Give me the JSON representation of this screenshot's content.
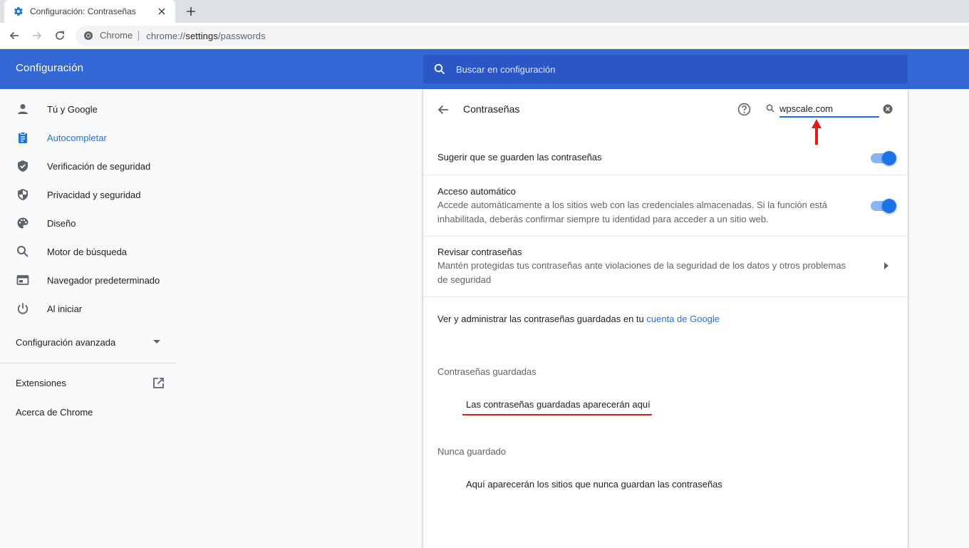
{
  "browser": {
    "tab_title": "Configuración: Contraseñas",
    "site_chip": "Chrome",
    "url_scheme": "chrome://",
    "url_host": "settings",
    "url_path": "/passwords"
  },
  "header": {
    "title": "Configuración",
    "search_placeholder": "Buscar en configuración"
  },
  "sidebar": {
    "items": [
      {
        "label": "Tú y Google",
        "icon": "person-icon"
      },
      {
        "label": "Autocompletar",
        "icon": "clipboard-icon",
        "active": true
      },
      {
        "label": "Verificación de seguridad",
        "icon": "shield-check-icon"
      },
      {
        "label": "Privacidad y seguridad",
        "icon": "shield-half-icon"
      },
      {
        "label": "Diseño",
        "icon": "palette-icon"
      },
      {
        "label": "Motor de búsqueda",
        "icon": "search-icon"
      },
      {
        "label": "Navegador predeterminado",
        "icon": "browser-window-icon"
      },
      {
        "label": "Al iniciar",
        "icon": "power-icon"
      }
    ],
    "advanced_label": "Configuración avanzada",
    "extensions_label": "Extensiones",
    "about_label": "Acerca de Chrome"
  },
  "passwords": {
    "title": "Contraseñas",
    "search_value": "wpscale.com",
    "offer_to_save": {
      "title": "Sugerir que se guarden las contraseñas",
      "enabled": true
    },
    "auto_signin": {
      "title": "Acceso automático",
      "subtitle": "Accede automáticamente a los sitios web con las credenciales almacenadas. Si la función está inhabilitada, deberás confirmar siempre tu identidad para acceder a un sitio web.",
      "enabled": true
    },
    "check_passwords": {
      "title": "Revisar contraseñas",
      "subtitle": "Mantén protegidas tus contraseñas ante violaciones de la seguridad de los datos y otros problemas de seguridad"
    },
    "manage_text": "Ver y administrar las contraseñas guardadas en tu ",
    "manage_link": "cuenta de Google",
    "saved_heading": "Contraseñas guardadas",
    "saved_empty": "Las contraseñas guardadas aparecerán aquí",
    "never_heading": "Nunca guardado",
    "never_empty": "Aquí aparecerán los sitios que nunca guardan las contraseñas"
  },
  "colors": {
    "header_blue": "#3367d6",
    "accent": "#1a73e8",
    "annotation_red": "#e51b1b"
  }
}
